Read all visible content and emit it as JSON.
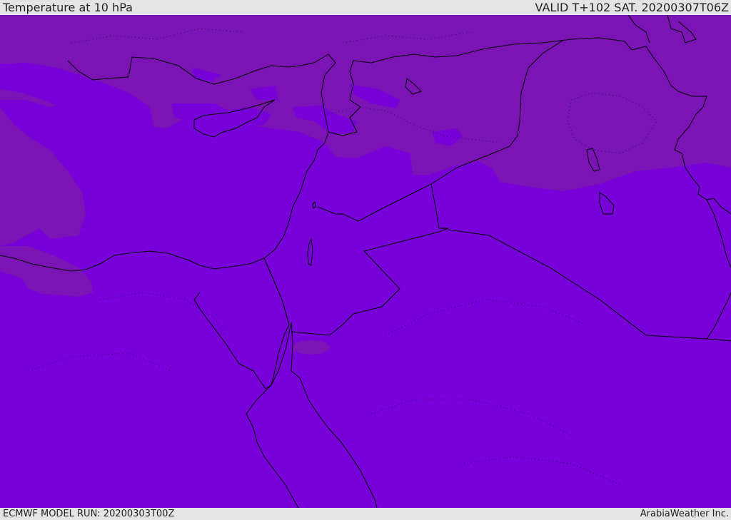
{
  "header": {
    "title": "Temperature at 10 hPa",
    "valid_time": "VALID T+102 SAT. 20200307T06Z"
  },
  "footer": {
    "model_run": "ECMWF MODEL RUN: 20200303T00Z",
    "credit": "ArabiaWeather Inc."
  },
  "colors": {
    "background_fill": "#7800d8",
    "warmer_band_fill": "#7a14b4",
    "coastline": "#000000",
    "bar_background": "#e4e4e4"
  },
  "map": {
    "field": "Temperature at 10 hPa"
  }
}
